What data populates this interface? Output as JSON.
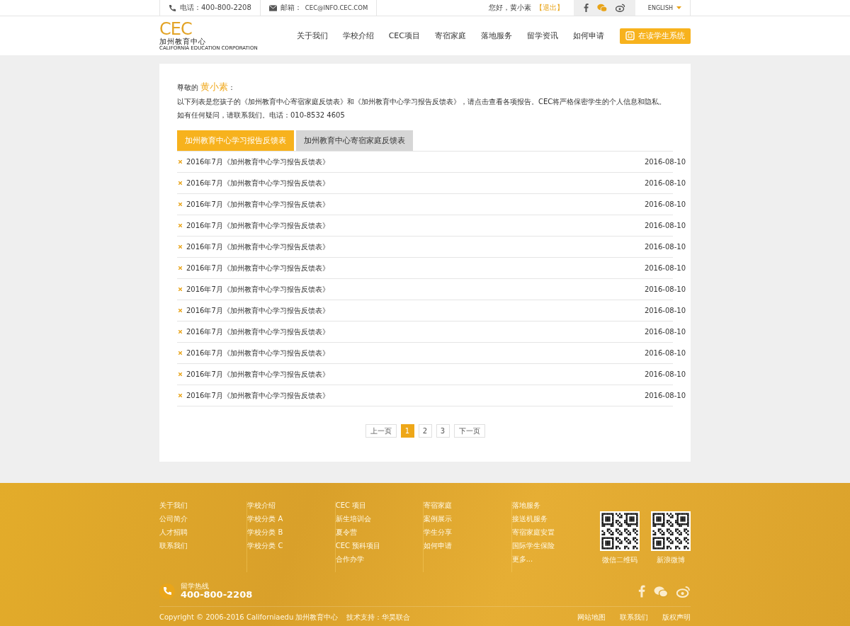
{
  "topbar": {
    "phone": "电话：400-800-2208",
    "email_label": "邮箱：",
    "email": "CEC@INFO.CEC.COM",
    "greeting": "您好，黄小素",
    "logout": "【退出】",
    "language": "ENGLISH"
  },
  "logo": {
    "mark": "CEC",
    "cn": "加州教育中心",
    "en": "CALIFORNIA EDUCATION CORPORATION"
  },
  "nav": [
    {
      "label": "关于我们"
    },
    {
      "label": "学校介绍"
    },
    {
      "label": "CEC项目"
    },
    {
      "label": "寄宿家庭"
    },
    {
      "label": "落地服务"
    },
    {
      "label": "留学资讯"
    },
    {
      "label": "如何申请"
    }
  ],
  "system_button": "在读学生系统",
  "intro": {
    "salutation": "尊敬的",
    "name": "黄小素",
    "colon": "：",
    "line1": "以下列表是您孩子的《加州教育中心寄宿家庭反馈表》和《加州教育中心学习报告反馈表》，请点击查看各项报告。CEC将严格保密学生的个人信息和隐私。",
    "line2": "如有任何疑问，请联系我们。电话：010-8532 4605"
  },
  "tabs": [
    {
      "label": "加州教育中心学习报告反馈表",
      "selected": true
    },
    {
      "label": "加州教育中心寄宿家庭反馈表",
      "selected": false
    }
  ],
  "reports": [
    {
      "title": "2016年7月《加州教育中心学习报告反馈表》",
      "date": "2016-08-10"
    },
    {
      "title": "2016年7月《加州教育中心学习报告反馈表》",
      "date": "2016-08-10"
    },
    {
      "title": "2016年7月《加州教育中心学习报告反馈表》",
      "date": "2016-08-10"
    },
    {
      "title": "2016年7月《加州教育中心学习报告反馈表》",
      "date": "2016-08-10"
    },
    {
      "title": "2016年7月《加州教育中心学习报告反馈表》",
      "date": "2016-08-10"
    },
    {
      "title": "2016年7月《加州教育中心学习报告反馈表》",
      "date": "2016-08-10"
    },
    {
      "title": "2016年7月《加州教育中心学习报告反馈表》",
      "date": "2016-08-10"
    },
    {
      "title": "2016年7月《加州教育中心学习报告反馈表》",
      "date": "2016-08-10"
    },
    {
      "title": "2016年7月《加州教育中心学习报告反馈表》",
      "date": "2016-08-10"
    },
    {
      "title": "2016年7月《加州教育中心学习报告反馈表》",
      "date": "2016-08-10"
    },
    {
      "title": "2016年7月《加州教育中心学习报告反馈表》",
      "date": "2016-08-10"
    },
    {
      "title": "2016年7月《加州教育中心学习报告反馈表》",
      "date": "2016-08-10"
    }
  ],
  "pagination": {
    "prev": "上一页",
    "next": "下一页",
    "pages": [
      {
        "label": "1",
        "selected": true
      },
      {
        "label": "2",
        "selected": false
      },
      {
        "label": "3",
        "selected": false
      }
    ]
  },
  "footer": {
    "columns": [
      [
        "关于我们",
        "公司简介",
        "人才招聘",
        "联系我们"
      ],
      [
        "学校介绍",
        "学校分类 A",
        "学校分类 B",
        "学校分类 C"
      ],
      [
        "CEC 项目",
        "新生培训会",
        "夏令营",
        "CEC 预科项目",
        "合作办学"
      ],
      [
        "寄宿家庭",
        "案例展示",
        "学生分享",
        "如何申请"
      ],
      [
        "落地服务",
        "接送机服务",
        "寄宿家庭安置",
        "国际学生保险",
        "更多..."
      ]
    ],
    "qr_codes": [
      {
        "caption": "微信二维码"
      },
      {
        "caption": "新浪微博"
      }
    ],
    "hotline_label": "留学热线",
    "hotline": "400-800-2208",
    "copyright": "Copyright © 2006-2016  Californiaedu 加州教育中心",
    "support": "技术支持：华昊联合",
    "links": [
      "网站地图",
      "联系我们",
      "版权声明"
    ]
  }
}
